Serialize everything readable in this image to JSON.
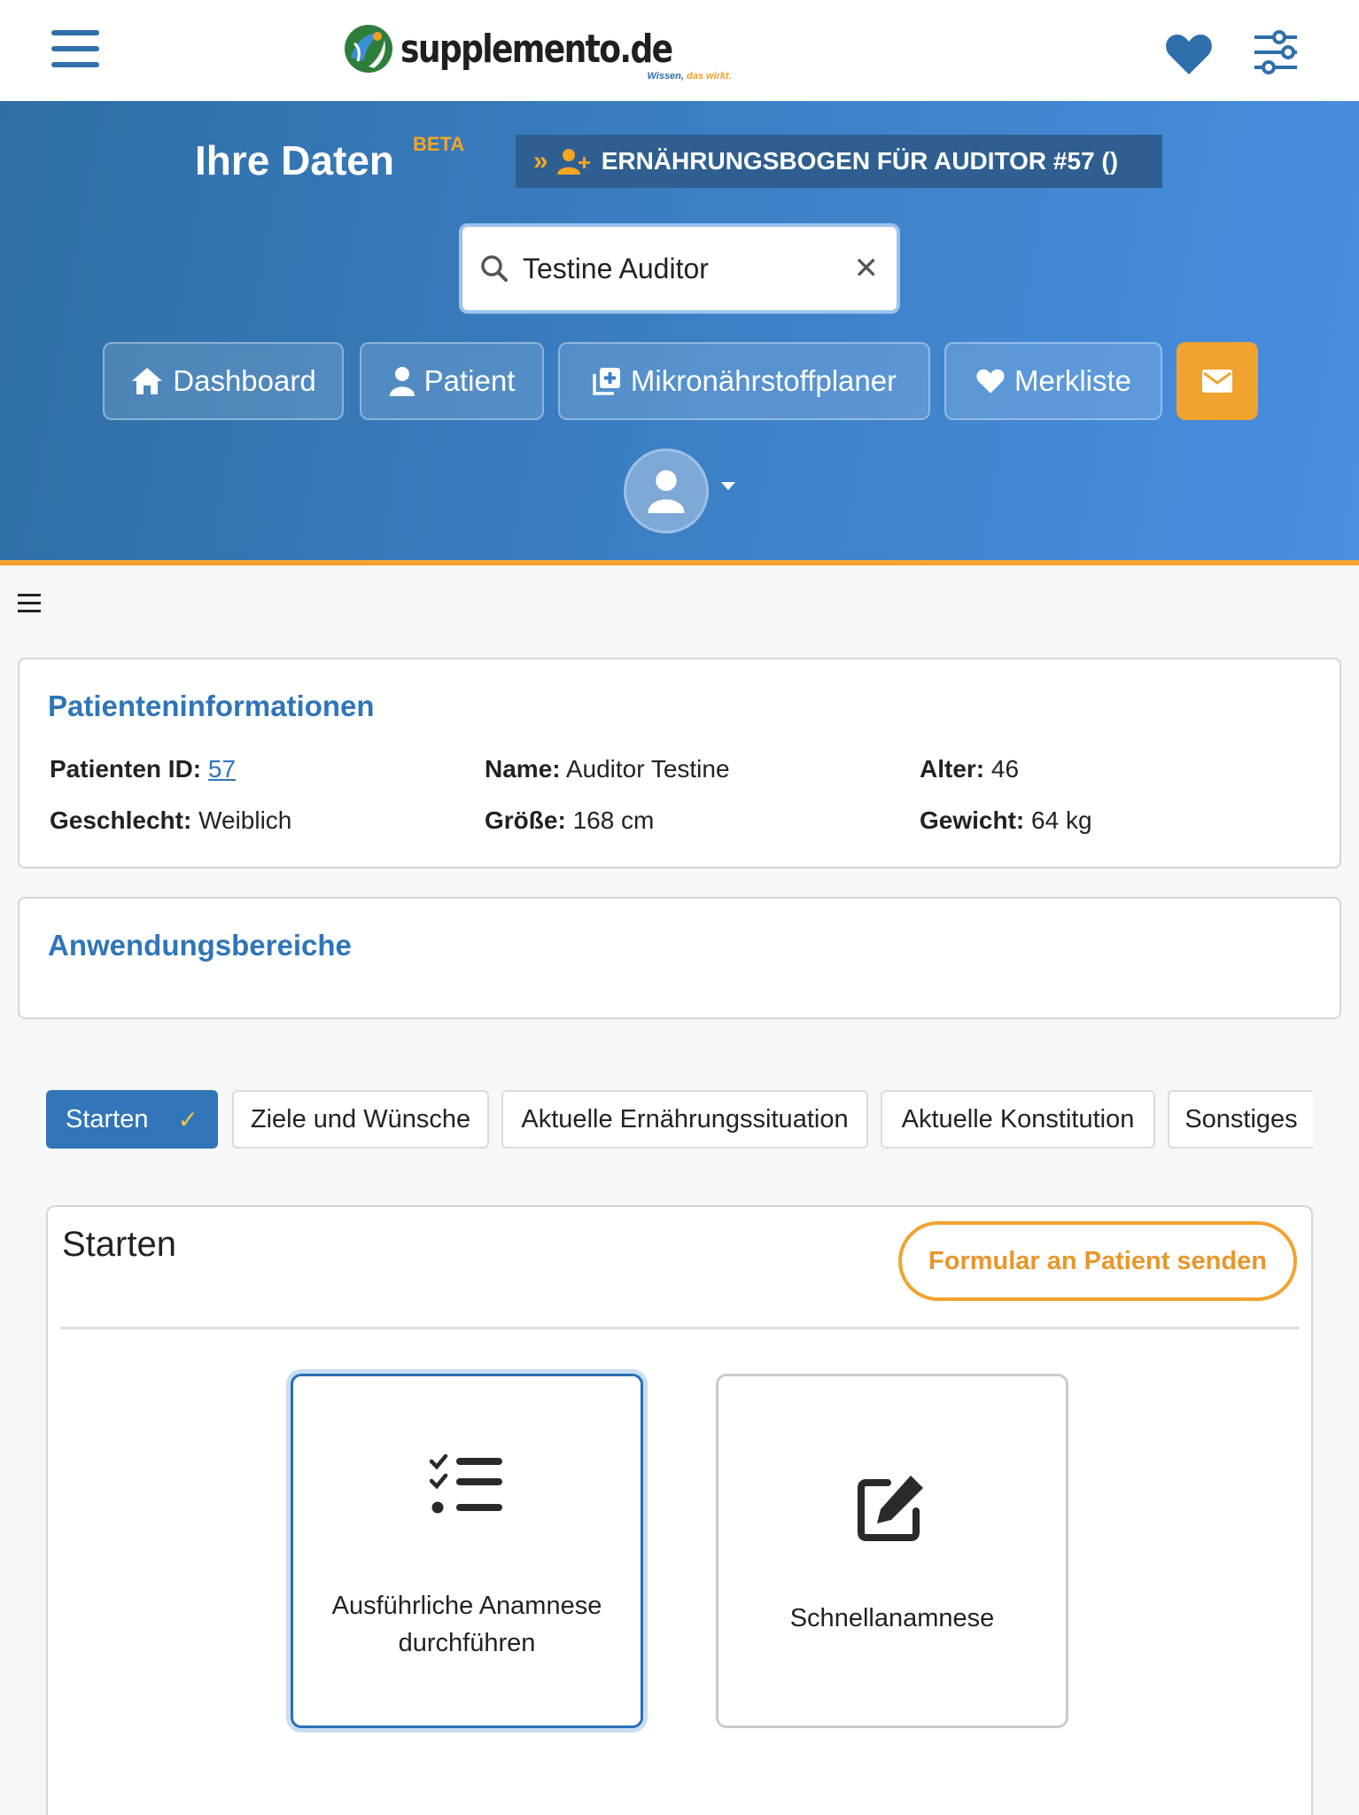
{
  "header": {
    "logo_text": "supplemento.de",
    "logo_tagline_1": "Wissen,",
    "logo_tagline_2": " das wirkt."
  },
  "hero": {
    "title": "Ihre Daten",
    "badge": "BETA",
    "form_pill": "ERNÄHRUNGSBOGEN FÜR AUDITOR #57 ()",
    "search_value": "Testine Auditor",
    "nav": {
      "dashboard": "Dashboard",
      "patient": "Patient",
      "planer": "Mikronährstoffplaner",
      "merkliste": "Merkliste"
    }
  },
  "patient_info": {
    "title": "Patienteninformationen",
    "id_label": "Patienten ID:",
    "id_value": "57",
    "name_label": "Name:",
    "name_value": "Auditor Testine",
    "age_label": "Alter:",
    "age_value": "46",
    "gender_label": "Geschlecht:",
    "gender_value": "Weiblich",
    "height_label": "Größe:",
    "height_value": "168 cm",
    "weight_label": "Gewicht:",
    "weight_value": "64 kg"
  },
  "areas": {
    "title": "Anwendungsbereiche"
  },
  "tabs": [
    {
      "label": "Starten",
      "active": true
    },
    {
      "label": "Ziele und Wünsche"
    },
    {
      "label": "Aktuelle Ernährungssituation"
    },
    {
      "label": "Aktuelle Konstitution"
    },
    {
      "label": "Sonstiges"
    }
  ],
  "starten": {
    "title": "Starten",
    "send_button": "Formular an Patient senden",
    "option_detailed_1": "Ausführliche Anamnese",
    "option_detailed_2": "durchführen",
    "option_quick": "Schnellanamnese"
  },
  "colors": {
    "primary": "#3275b8",
    "accent": "#f0a32f"
  }
}
